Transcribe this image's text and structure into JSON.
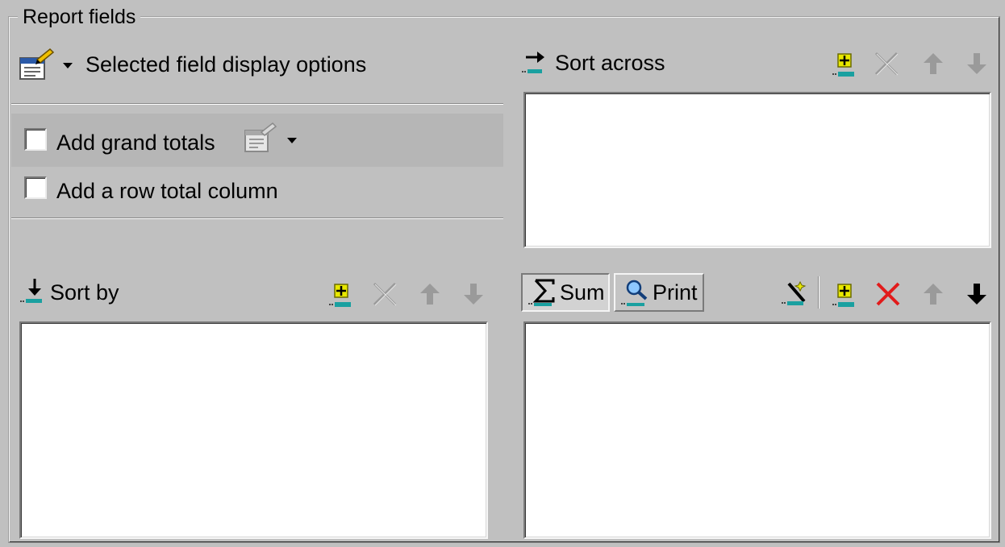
{
  "group": {
    "title": "Report fields"
  },
  "display_options": {
    "label": "Selected field display options"
  },
  "totals": {
    "grand_totals_label": "Add grand totals",
    "grand_totals_checked": false,
    "row_total_label": "Add a row total column",
    "row_total_checked": false
  },
  "sort_across": {
    "label": "Sort across"
  },
  "sort_by": {
    "label": "Sort by"
  },
  "measures": {
    "sum_label": "Sum",
    "print_label": "Print"
  },
  "icons": [
    "settings-icon",
    "add-field-icon",
    "delete-icon",
    "move-up-icon",
    "move-down-icon",
    "sum-icon",
    "print-icon",
    "wizard-icon"
  ],
  "colors": {
    "background": "#c0c0c0",
    "add_plus": "#e8e800",
    "add_bar": "#1aa0a0",
    "delete_active": "#e21b1b"
  }
}
